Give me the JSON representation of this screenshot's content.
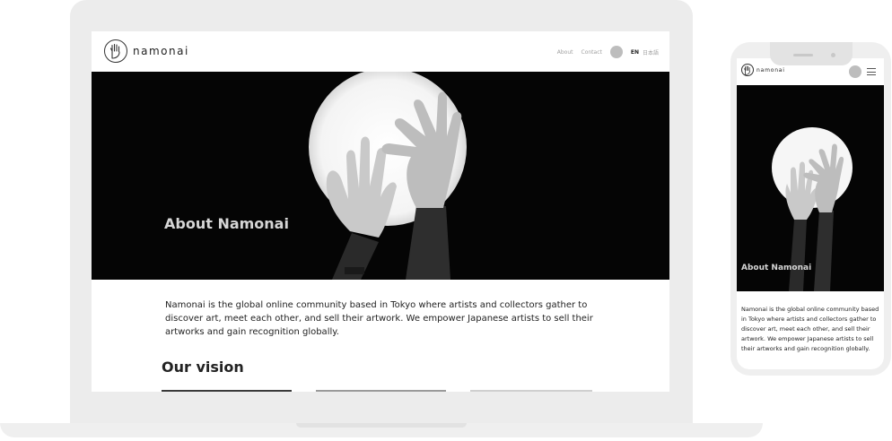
{
  "desktop": {
    "brand": "namonai",
    "nav": {
      "about": "About",
      "contact": "Contact",
      "lang_en": "EN",
      "lang_ja": "日本語"
    },
    "hero_title": "About Namonai",
    "about_text": "Namonai is the global online community based in Tokyo where artists and collectors gather to discover art, meet each other, and sell their artwork. We empower Japanese artists to sell their artworks and gain recognition globally.",
    "vision_heading": "Our vision"
  },
  "mobile": {
    "brand": "namonai",
    "hero_title": "About Namonai",
    "about_text": "Namonai is the global online community based in Tokyo where artists and collectors gather to discover art, meet each other, and sell their artwork. We empower Japanese artists to sell their artworks and gain recognition globally."
  },
  "icons": {
    "logo": "hand-logo-icon",
    "menu": "hamburger-menu-icon",
    "avatar": "user-avatar"
  },
  "colors": {
    "hero_bg": "#050505",
    "hero_title": "#d6d6d6",
    "text": "#222222",
    "nav_link": "#a0a0a0",
    "device_frame": "#ececec"
  }
}
